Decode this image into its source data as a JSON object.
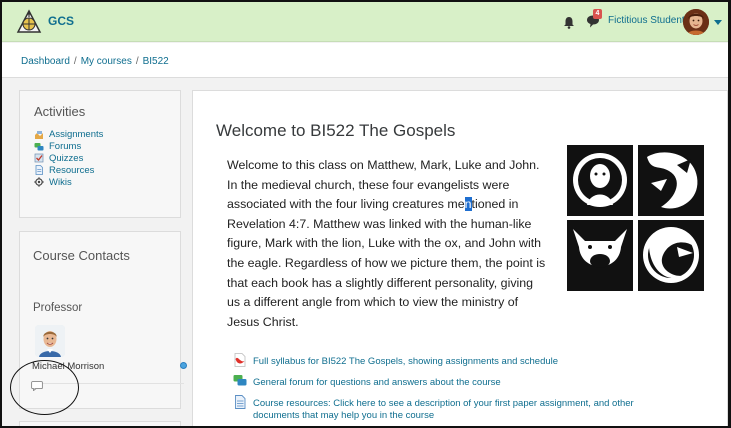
{
  "navbar": {
    "brand": "GCS",
    "messages_count": "4",
    "user_name": "Fictitious Student"
  },
  "breadcrumb": {
    "items": [
      "Dashboard",
      "My courses",
      "BI522"
    ],
    "separator": "/"
  },
  "activities": {
    "title": "Activities",
    "items": [
      "Assignments",
      "Forums",
      "Quizzes",
      "Resources",
      "Wikis"
    ]
  },
  "contacts": {
    "title": "Course Contacts",
    "role": "Professor",
    "name": "Michael Morrison"
  },
  "main": {
    "title": "Welcome to BI522 The Gospels",
    "intro_lines": [
      "Welcome to this class on Matthew, Mark, Luke and John.",
      "In the medieval church, these four evangelists were",
      "Revelation 4:7. Matthew was linked with the human-like",
      "figure, Mark with the lion, Luke with the ox, and John with",
      "the eagle. Regardless of how we picture them, the point is",
      "that each book has a slightly different personality, giving",
      "us a different angle from which to view the ministry of",
      "Jesus Christ."
    ],
    "intro_line3_before": "associated with the four living creatures me",
    "intro_line3_cursor": "n",
    "intro_line3_after": "tioned in",
    "resources": [
      "Full syllabus for BI522 The Gospels, showing assignments and schedule",
      "General forum for questions and answers about the course",
      "Course resources: Click here to see a description of your first paper assignment, and other",
      "documents that may help you in the course"
    ]
  },
  "colors": {
    "navbar_bg": "#d8f0c8",
    "link": "#0f6e8f",
    "badge": "#d9534f"
  }
}
